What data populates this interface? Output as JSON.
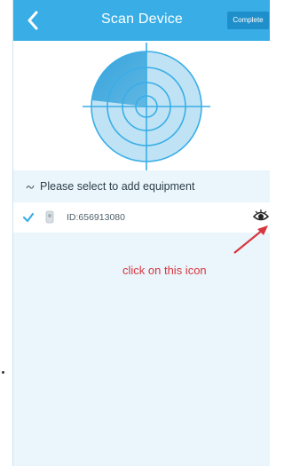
{
  "nav": {
    "back_icon": "chevron-left-icon",
    "title": "Scan Device",
    "complete_label": "Complete"
  },
  "colors": {
    "accent": "#39aee6",
    "button": "#1f8fcb",
    "annotation": "#d9363e",
    "panel_bg": "#eaf6fc"
  },
  "scan": {
    "icon": "radar-icon"
  },
  "prompt": {
    "icon": "scan-wave-icon",
    "text": "Please select to add equipment"
  },
  "devices": [
    {
      "selected": true,
      "check_icon": "checkmark-icon",
      "thumb_icon": "camera-icon",
      "id_label": "ID:656913080",
      "action_icon": "eye-icon"
    }
  ],
  "annotation": {
    "text": "click on this icon"
  }
}
